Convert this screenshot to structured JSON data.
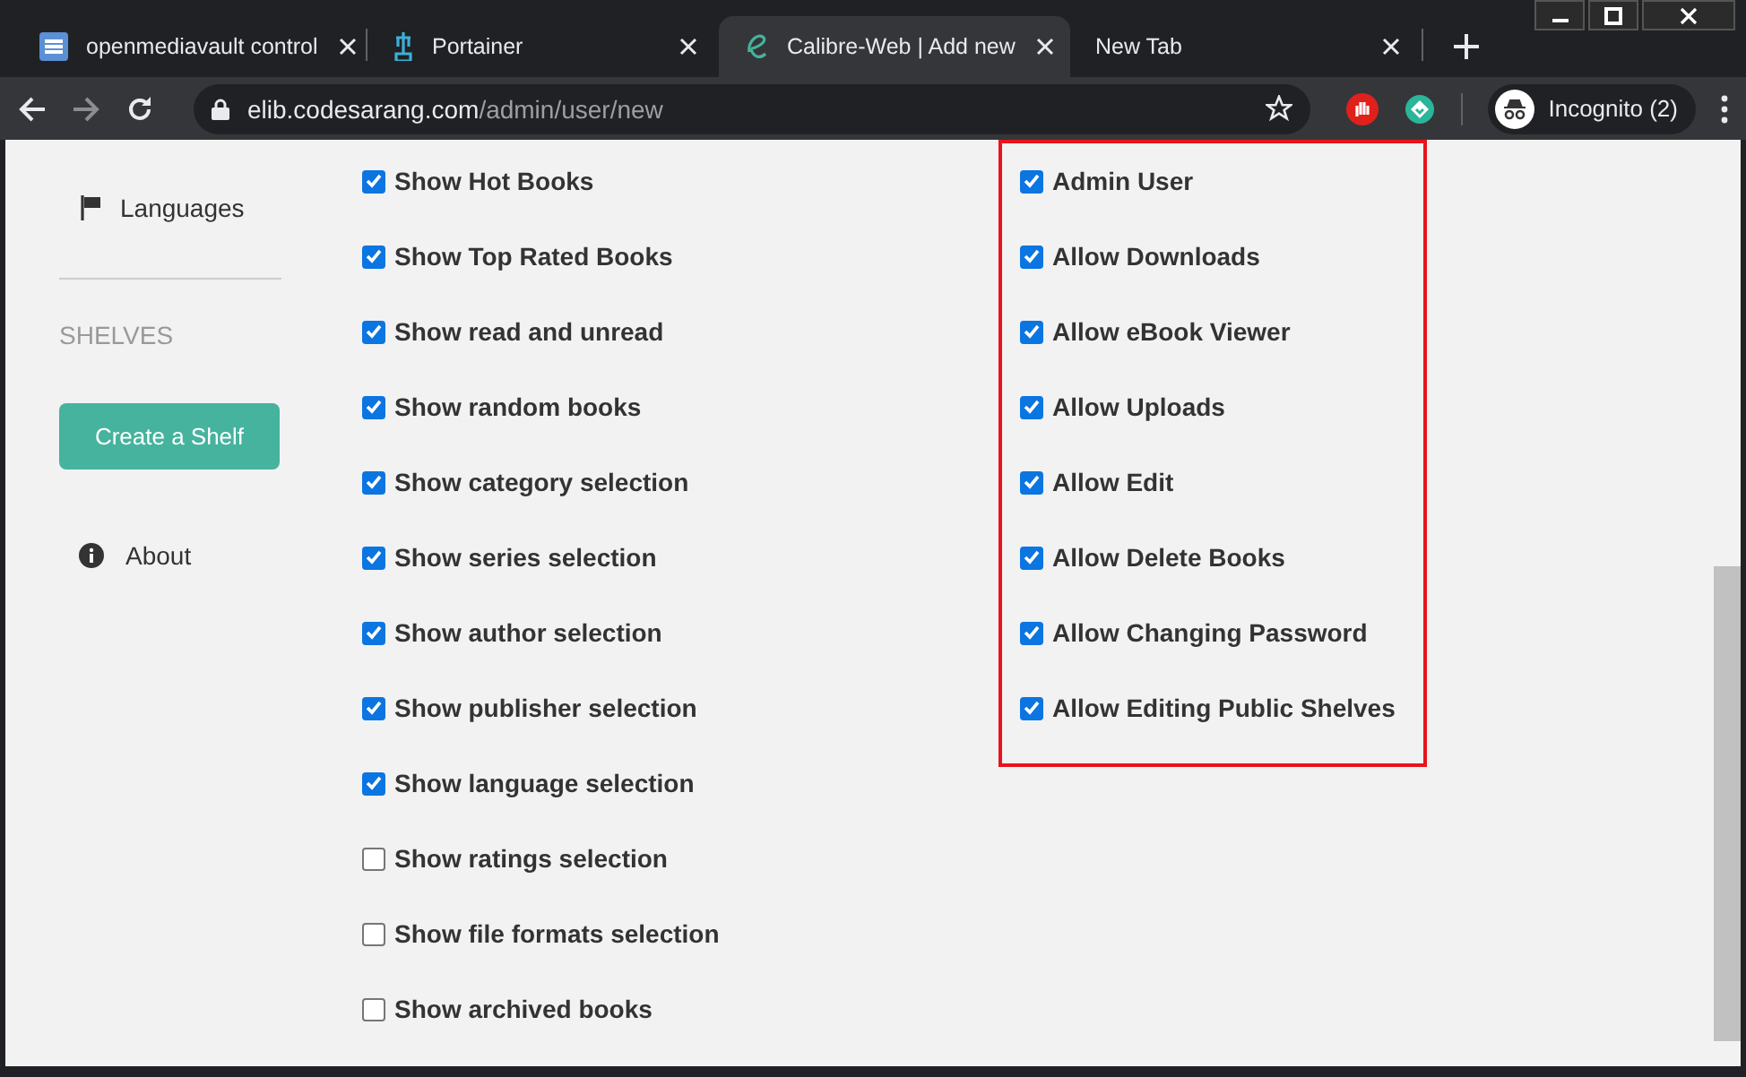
{
  "browser": {
    "tabs": [
      {
        "title": "openmediavault control",
        "selected": false
      },
      {
        "title": "Portainer",
        "selected": false
      },
      {
        "title": "Calibre-Web | Add new",
        "selected": true
      },
      {
        "title": "New Tab",
        "selected": false
      }
    ],
    "address": {
      "host": "elib.codesarang.com",
      "path": "/admin/user/new"
    },
    "profile": "Incognito (2)"
  },
  "sidebar": {
    "items": [
      {
        "label": "Languages",
        "kind": "flag"
      }
    ],
    "section": "SHELVES",
    "button": "Create a Shelf",
    "footer": {
      "label": "About",
      "kind": "info"
    }
  },
  "visibility_options": [
    {
      "label": "Show Hot Books",
      "checked": true
    },
    {
      "label": "Show Top Rated Books",
      "checked": true
    },
    {
      "label": "Show read and unread",
      "checked": true
    },
    {
      "label": "Show random books",
      "checked": true
    },
    {
      "label": "Show category selection",
      "checked": true
    },
    {
      "label": "Show series selection",
      "checked": true
    },
    {
      "label": "Show author selection",
      "checked": true
    },
    {
      "label": "Show publisher selection",
      "checked": true
    },
    {
      "label": "Show language selection",
      "checked": true
    },
    {
      "label": "Show ratings selection",
      "checked": false
    },
    {
      "label": "Show file formats selection",
      "checked": false
    },
    {
      "label": "Show archived books",
      "checked": false
    }
  ],
  "permissions": {
    "highlighted": true,
    "items": [
      {
        "label": "Admin User",
        "checked": true
      },
      {
        "label": "Allow Downloads",
        "checked": true
      },
      {
        "label": "Allow eBook Viewer",
        "checked": true
      },
      {
        "label": "Allow Uploads",
        "checked": true
      },
      {
        "label": "Allow Edit",
        "checked": true
      },
      {
        "label": "Allow Delete Books",
        "checked": true
      },
      {
        "label": "Allow Changing Password",
        "checked": true
      },
      {
        "label": "Allow Editing Public Shelves",
        "checked": true
      }
    ]
  }
}
